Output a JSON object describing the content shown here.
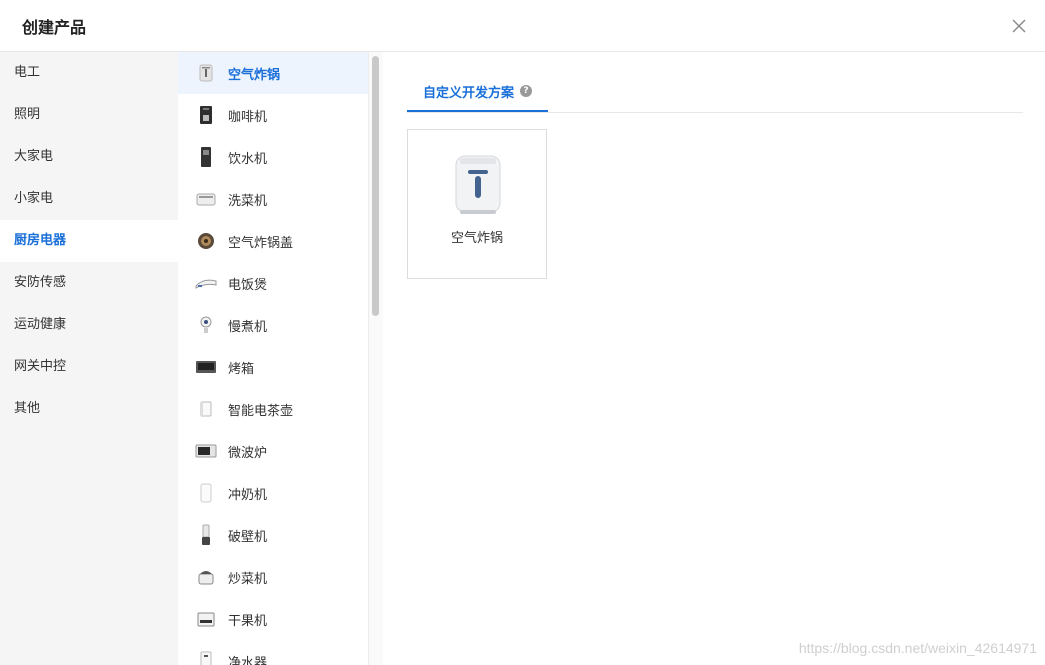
{
  "dialog": {
    "title": "创建产品",
    "close_icon": "close-icon"
  },
  "categories": [
    {
      "label": "电工"
    },
    {
      "label": "照明"
    },
    {
      "label": "大家电"
    },
    {
      "label": "小家电"
    },
    {
      "label": "厨房电器",
      "active": true
    },
    {
      "label": "安防传感"
    },
    {
      "label": "运动健康"
    },
    {
      "label": "网关中控"
    },
    {
      "label": "其他"
    }
  ],
  "products": [
    {
      "label": "空气炸锅",
      "icon": "air-fryer-icon",
      "active": true
    },
    {
      "label": "咖啡机",
      "icon": "coffee-machine-icon"
    },
    {
      "label": "饮水机",
      "icon": "water-dispenser-icon"
    },
    {
      "label": "洗菜机",
      "icon": "vegetable-washer-icon"
    },
    {
      "label": "空气炸锅盖",
      "icon": "air-fryer-lid-icon"
    },
    {
      "label": "电饭煲",
      "icon": "rice-cooker-icon"
    },
    {
      "label": "慢煮机",
      "icon": "slow-cooker-icon"
    },
    {
      "label": "烤箱",
      "icon": "oven-icon"
    },
    {
      "label": "智能电茶壶",
      "icon": "smart-kettle-icon"
    },
    {
      "label": "微波炉",
      "icon": "microwave-icon"
    },
    {
      "label": "冲奶机",
      "icon": "formula-maker-icon"
    },
    {
      "label": "破壁机",
      "icon": "blender-icon"
    },
    {
      "label": "炒菜机",
      "icon": "cooking-robot-icon"
    },
    {
      "label": "干果机",
      "icon": "nut-roaster-icon"
    },
    {
      "label": "净水器",
      "icon": "water-purifier-icon"
    }
  ],
  "main": {
    "tab_label": "自定义开发方案",
    "help_icon": "?",
    "card_label": "空气炸锅"
  },
  "watermark": "https://blog.csdn.net/weixin_42614971",
  "colors": {
    "accent": "#1a6fd8",
    "category_bg": "#f5f5f5",
    "active_product_bg": "#eef4fd"
  }
}
